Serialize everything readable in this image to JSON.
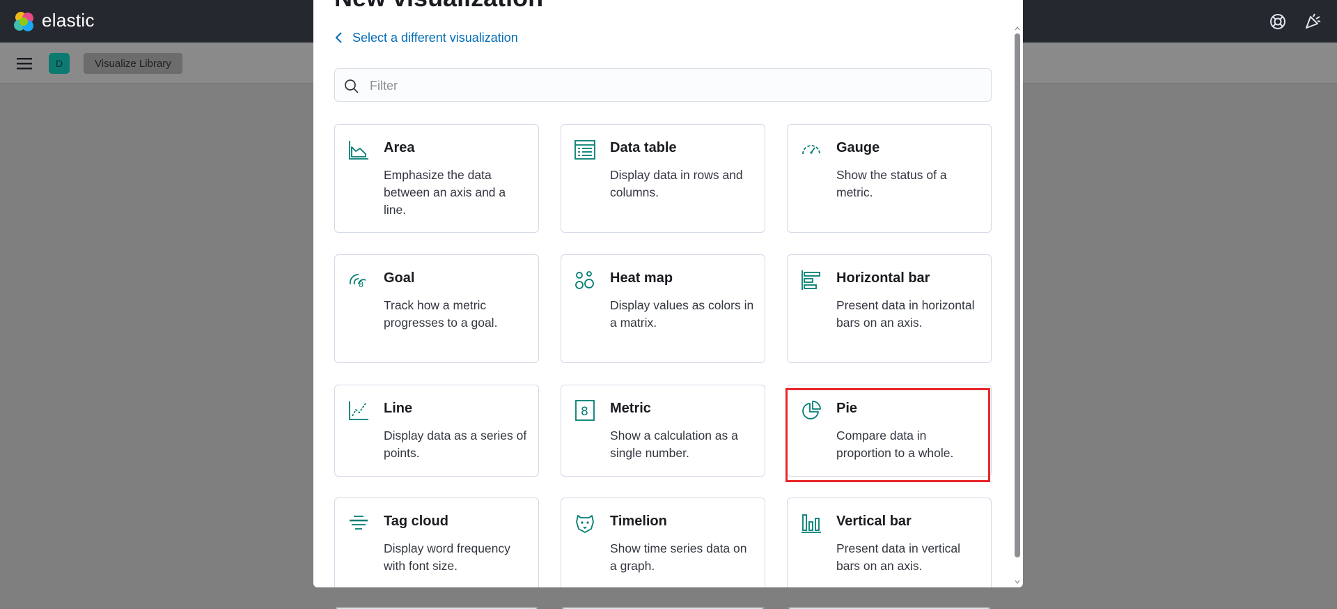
{
  "header": {
    "brand": "elastic"
  },
  "subheader": {
    "space_initial": "D",
    "breadcrumb": "Visualize Library"
  },
  "modal": {
    "title": "New visualization",
    "back_label": "Select a different visualization",
    "filter_placeholder": "Filter",
    "cards": [
      {
        "title": "Area",
        "desc": "Emphasize the data between an axis and a line."
      },
      {
        "title": "Data table",
        "desc": "Display data in rows and columns."
      },
      {
        "title": "Gauge",
        "desc": "Show the status of a metric."
      },
      {
        "title": "Goal",
        "desc": "Track how a metric progresses to a goal."
      },
      {
        "title": "Heat map",
        "desc": "Display values as colors in a matrix."
      },
      {
        "title": "Horizontal bar",
        "desc": "Present data in horizontal bars on an axis."
      },
      {
        "title": "Line",
        "desc": "Display data as a series of points."
      },
      {
        "title": "Metric",
        "desc": "Show a calculation as a single number."
      },
      {
        "title": "Pie",
        "desc": "Compare data in proportion to a whole."
      },
      {
        "title": "Tag cloud",
        "desc": "Display word frequency with font size."
      },
      {
        "title": "Timelion",
        "desc": "Show time series data on a graph."
      },
      {
        "title": "Vertical bar",
        "desc": "Present data in vertical bars on an axis."
      }
    ]
  },
  "colors": {
    "accent": "#006bb8",
    "icon": "#017d73",
    "highlight": "#e8262a",
    "header_bg": "#25282f"
  }
}
